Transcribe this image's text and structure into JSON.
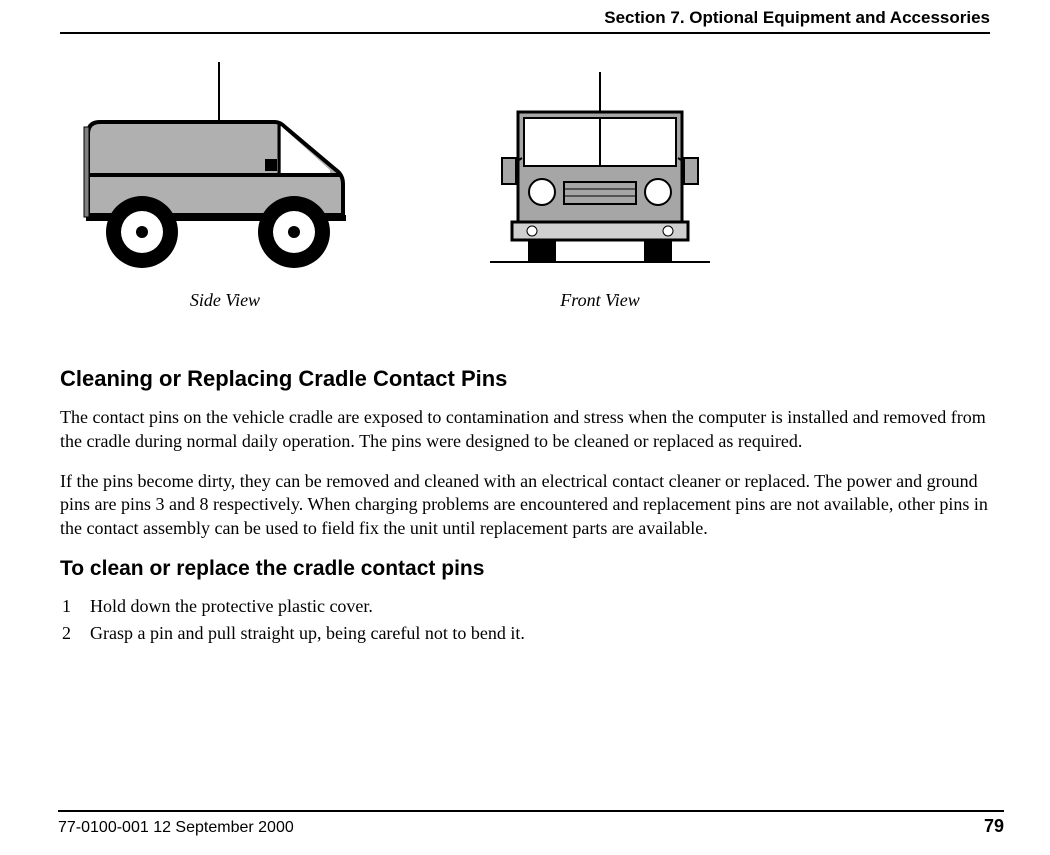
{
  "header": {
    "section_title": "Section 7. Optional Equipment and Accessories"
  },
  "figures": {
    "side_caption": "Side View",
    "front_caption": "Front View"
  },
  "body": {
    "heading": "Cleaning or Replacing Cradle Contact Pins",
    "para1": "The contact pins on the vehicle cradle are exposed to contamination and stress when the computer is installed and removed from the cradle during normal daily operation. The pins were designed to be cleaned or replaced as required.",
    "para2": "If the pins become dirty, they can be removed and cleaned with an electrical contact cleaner or replaced. The power and ground pins are pins 3 and 8 respectively. When charging problems are encountered and replacement pins are not available, other pins in the contact assembly can be used to field fix the unit until replacement parts are available.",
    "subheading": "To clean or replace the cradle contact pins",
    "steps": [
      "Hold down the protective plastic cover.",
      "Grasp a pin and pull straight up, being careful not to bend it."
    ]
  },
  "footer": {
    "doc_id": "77-0100-001   12 September 2000",
    "page_number": "79"
  }
}
